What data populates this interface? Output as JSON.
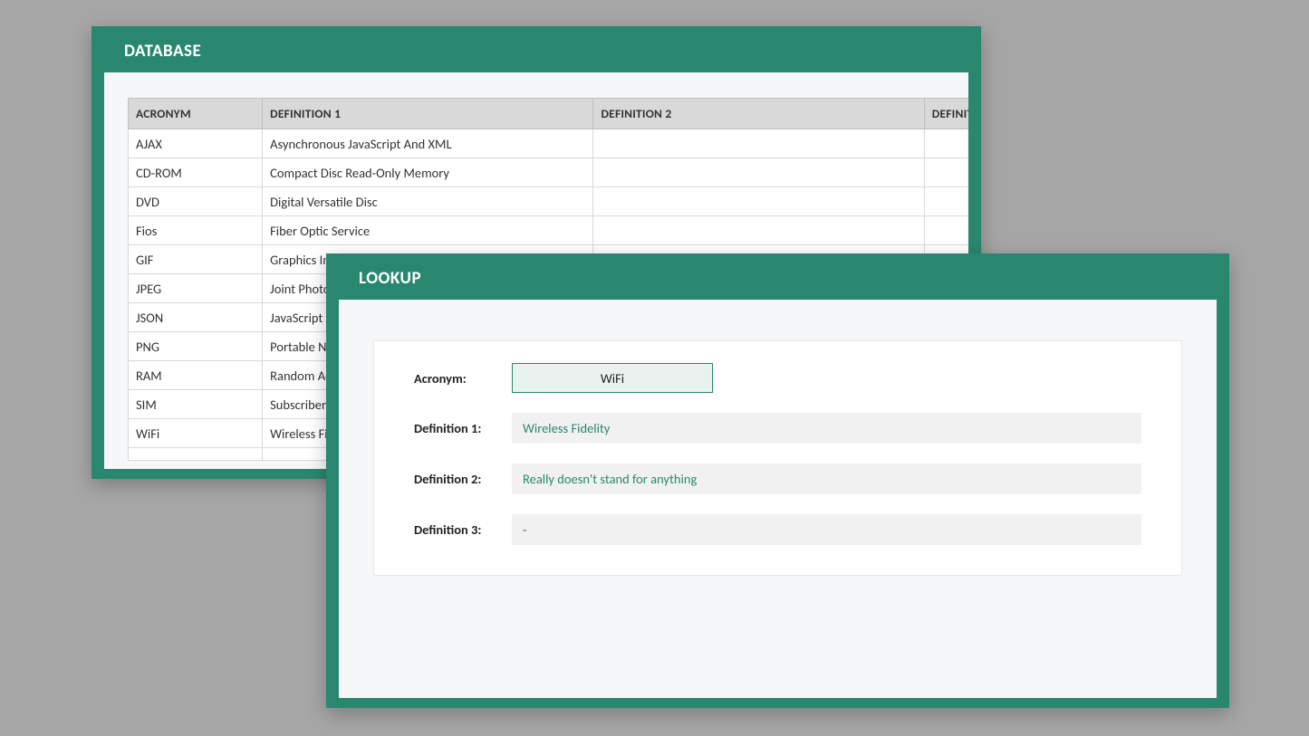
{
  "database": {
    "title": "DATABASE",
    "headers": {
      "acronym": "ACRONYM",
      "def1": "DEFINITION 1",
      "def2": "DEFINITION 2",
      "def3": "DEFINITION"
    },
    "rows": [
      {
        "acronym": "AJAX",
        "def1": "Asynchronous JavaScript And XML",
        "def2": "",
        "def3": ""
      },
      {
        "acronym": "CD-ROM",
        "def1": "Compact Disc Read-Only Memory",
        "def2": "",
        "def3": ""
      },
      {
        "acronym": "DVD",
        "def1": "Digital Versatile Disc",
        "def2": "",
        "def3": ""
      },
      {
        "acronym": "Fios",
        "def1": "Fiber Optic Service",
        "def2": "",
        "def3": ""
      },
      {
        "acronym": "GIF",
        "def1": "Graphics Inte",
        "def2": "",
        "def3": ""
      },
      {
        "acronym": "JPEG",
        "def1": "Joint Photogr",
        "def2": "",
        "def3": ""
      },
      {
        "acronym": "JSON",
        "def1": "JavaScript Ob",
        "def2": "",
        "def3": ""
      },
      {
        "acronym": "PNG",
        "def1": "Portable Netw",
        "def2": "",
        "def3": ""
      },
      {
        "acronym": "RAM",
        "def1": "Random Acce",
        "def2": "",
        "def3": ""
      },
      {
        "acronym": "SIM",
        "def1": "Subscriber Id",
        "def2": "",
        "def3": ""
      },
      {
        "acronym": "WiFi",
        "def1": "Wireless Fide",
        "def2": "",
        "def3": ""
      },
      {
        "acronym": "",
        "def1": "",
        "def2": "",
        "def3": ""
      }
    ]
  },
  "lookup": {
    "title": "LOOKUP",
    "labels": {
      "acronym": "Acronym:",
      "def1": "Definition 1:",
      "def2": "Definition 2:",
      "def3": "Definition 3:"
    },
    "acronym_value": "WiFi",
    "def1": "Wireless Fidelity",
    "def2": "Really doesn't stand for anything",
    "def3": "-"
  }
}
